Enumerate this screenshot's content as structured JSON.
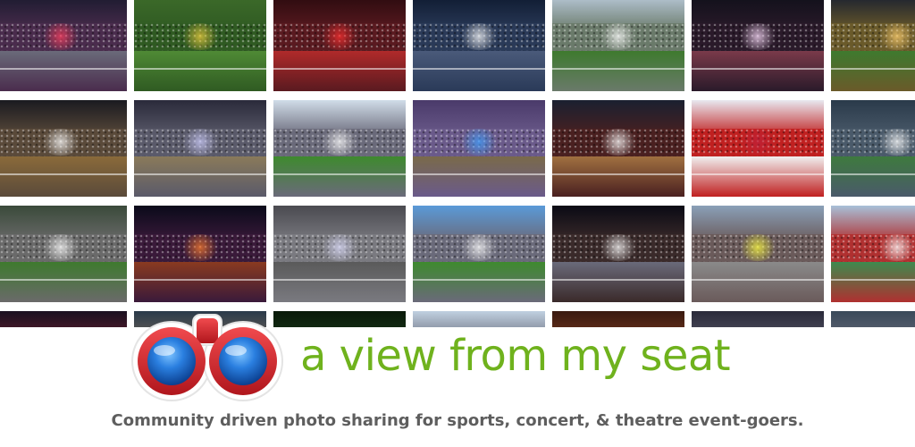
{
  "banner": {
    "brand_name": "a view from my seat",
    "tagline": "Community driven photo sharing for sports, concert, & theatre event-goers.",
    "logo_icon": "binoculars-icon",
    "colors": {
      "brand_green": "#6fb21d",
      "tagline_gray": "#5e5e5e",
      "binocular_red": "#d9262c",
      "binocular_lens_blue": "#1f6fd1"
    }
  },
  "photo_tiles": [
    {
      "name": "photo-wrestling-arena",
      "palette": [
        "#1a1a2e",
        "#4a2c4d",
        "#6a6a7a"
      ],
      "light": "#ff4060"
    },
    {
      "name": "photo-football-players",
      "palette": [
        "#3d6b2a",
        "#2f5a22",
        "#4f8a35"
      ],
      "light": "#f0d040"
    },
    {
      "name": "photo-hockey-rink-lights",
      "palette": [
        "#2a0a0e",
        "#5a1a20",
        "#b02a2a"
      ],
      "light": "#ff3030"
    },
    {
      "name": "photo-concert-arena",
      "palette": [
        "#0e1a30",
        "#2a3a58",
        "#4a5a7a"
      ],
      "light": "#ffffff"
    },
    {
      "name": "photo-baseball-day",
      "palette": [
        "#b8c8d8",
        "#6a7a6a",
        "#3e7a2e"
      ],
      "light": "#ffffff"
    },
    {
      "name": "photo-arena-scoreboard",
      "palette": [
        "#10101a",
        "#2a1a2a",
        "#7a3a4a"
      ],
      "light": "#ffe0ff"
    },
    {
      "name": "photo-football-stadium-night",
      "palette": [
        "#1a2030",
        "#6a5a2a",
        "#3e7a2e"
      ],
      "light": "#ffd070"
    },
    {
      "name": "photo-rodeo-arena",
      "palette": [
        "#1a1a20",
        "#5a4a3a",
        "#8a6a3a"
      ],
      "light": "#ffffff"
    },
    {
      "name": "photo-monster-truck-dirt",
      "palette": [
        "#2a2a3a",
        "#5a5a6a",
        "#8a7a5a"
      ],
      "light": "#d0d0ff"
    },
    {
      "name": "photo-yankee-stadium",
      "palette": [
        "#d0dce8",
        "#6a6a7a",
        "#3e8a2e"
      ],
      "light": "#ffffff"
    },
    {
      "name": "photo-monster-truck-jump",
      "palette": [
        "#4a3a6a",
        "#6a5a8a",
        "#7a6a4a"
      ],
      "light": "#40a0ff"
    },
    {
      "name": "photo-basketball-dunk",
      "palette": [
        "#1a2030",
        "#4a2020",
        "#a07040"
      ],
      "light": "#ffffff"
    },
    {
      "name": "photo-hockey-players",
      "palette": [
        "#e8e8f0",
        "#c02020",
        "#f0f0f0"
      ],
      "light": "#c0203a"
    },
    {
      "name": "photo-indoor-lacrosse",
      "palette": [
        "#2a3a4a",
        "#4a5a6a",
        "#3e7a3e"
      ],
      "light": "#ffffff"
    },
    {
      "name": "photo-baseball-lineup",
      "palette": [
        "#3a4a3a",
        "#6a6a6a",
        "#3e7a2e"
      ],
      "light": "#ffffff"
    },
    {
      "name": "photo-concert-fire",
      "palette": [
        "#0a0a1a",
        "#3a1a3a",
        "#8a3a20"
      ],
      "light": "#ff8030"
    },
    {
      "name": "photo-theatre-flag",
      "palette": [
        "#4a4a50",
        "#7a7a80",
        "#5a5a5a"
      ],
      "light": "#e0e0ff"
    },
    {
      "name": "photo-ballpark-fans",
      "palette": [
        "#5a9ad8",
        "#6a6a7a",
        "#3e8a2e"
      ],
      "light": "#ffffff"
    },
    {
      "name": "photo-ufc-octagon",
      "palette": [
        "#0a0a14",
        "#3a2a2a",
        "#6a6a7a"
      ],
      "light": "#ffffff"
    },
    {
      "name": "photo-indycar-race",
      "palette": [
        "#8aa0b8",
        "#6a5a5a",
        "#8a8a8a"
      ],
      "light": "#ffff40"
    },
    {
      "name": "photo-soccer-stadium-seats",
      "palette": [
        "#a8c0d8",
        "#b03030",
        "#3e8a4e"
      ],
      "light": "#ffffff"
    },
    {
      "name": "photo-arena-red-seats",
      "palette": [
        "#1a1020",
        "#6a2030",
        "#4a3040"
      ],
      "light": "#ff4040"
    },
    {
      "name": "photo-dome-interior",
      "palette": [
        "#2a3a4a",
        "#7a6a5a",
        "#4a5a4a"
      ],
      "light": "#ffffff"
    },
    {
      "name": "photo-concert-green-lights",
      "palette": [
        "#0a1a0a",
        "#1a3a1a",
        "#204020"
      ],
      "light": "#40ff60"
    },
    {
      "name": "photo-outdoor-stadium-wide",
      "palette": [
        "#c0d0e0",
        "#5a5a6a",
        "#d0d0d0"
      ],
      "light": "#ffffff"
    },
    {
      "name": "photo-theatre-curtain",
      "palette": [
        "#3a1a10",
        "#7a3a20",
        "#8a2a1a"
      ],
      "light": "#ffc070"
    },
    {
      "name": "photo-arena-upper-deck",
      "palette": [
        "#2a2a3a",
        "#5a5a6a",
        "#3a3a4a"
      ],
      "light": "#ffe080"
    },
    {
      "name": "photo-arena-lower-bowl",
      "palette": [
        "#3a4a5a",
        "#6a6a7a",
        "#4a4a5a"
      ],
      "light": "#ffffff"
    }
  ]
}
